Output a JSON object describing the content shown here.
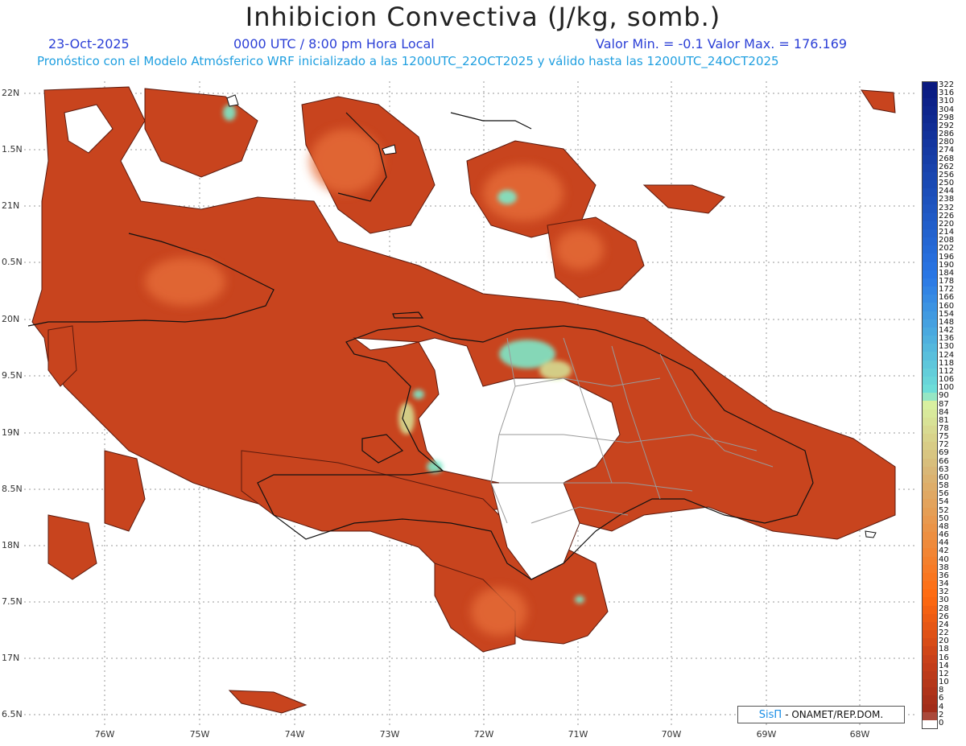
{
  "header": {
    "title": "Inhibicion Convectiva (J/kg, somb.)",
    "date": "23-Oct-2025",
    "time": "0000 UTC / 8:00 pm Hora Local",
    "minmax": "Valor Min. = -0.1  Valor Max. = 176.169",
    "subtitle": "Pronóstico con el Modelo Atmósferico WRF inicializado a las 1200UTC_22OCT2025 y válido hasta las  1200UTC_24OCT2025"
  },
  "axes": {
    "lat_labels": [
      "22N",
      "1.5N",
      "21N",
      "0.5N",
      "20N",
      "9.5N",
      "19N",
      "8.5N",
      "18N",
      "7.5N",
      "17N",
      "6.5N"
    ],
    "lon_labels": [
      "76W",
      "75W",
      "74W",
      "73W",
      "72W",
      "71W",
      "70W",
      "69W",
      "68W"
    ]
  },
  "colorbar": {
    "labels": [
      "322",
      "316",
      "310",
      "304",
      "298",
      "292",
      "286",
      "280",
      "274",
      "268",
      "262",
      "256",
      "250",
      "244",
      "238",
      "232",
      "226",
      "220",
      "214",
      "208",
      "202",
      "196",
      "190",
      "184",
      "178",
      "172",
      "166",
      "160",
      "154",
      "148",
      "142",
      "136",
      "130",
      "124",
      "118",
      "112",
      "106",
      "100",
      "90",
      "87",
      "84",
      "81",
      "78",
      "75",
      "72",
      "69",
      "66",
      "63",
      "60",
      "58",
      "56",
      "54",
      "52",
      "50",
      "48",
      "46",
      "44",
      "42",
      "40",
      "38",
      "36",
      "34",
      "32",
      "30",
      "28",
      "26",
      "24",
      "22",
      "20",
      "18",
      "16",
      "14",
      "12",
      "10",
      "8",
      "6",
      "4",
      "2",
      "0"
    ],
    "colors": {
      "high": "#0a1a80",
      "blue": "#2a78e6",
      "cyan": "#6fe0d8",
      "green": "#d8f0a0",
      "tan": "#d8b878",
      "orange": "#ff6a10",
      "red": "#c8401a",
      "brown": "#9c2a1a",
      "zero": "#ffffff"
    }
  },
  "map": {
    "base_color": "#c8441e",
    "light_color": "#e8703a",
    "cyan_color": "#7ee8c8"
  },
  "credit": {
    "brand": "SisΠ",
    "org": "- ONAMET/REP.DOM."
  }
}
